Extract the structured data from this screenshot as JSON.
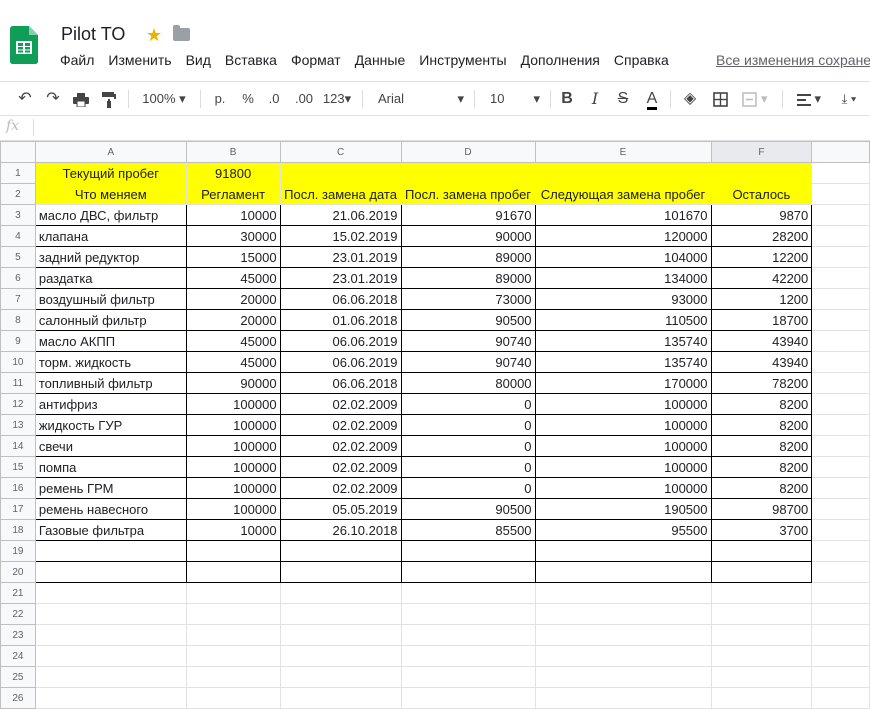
{
  "app": {
    "title": "Pilot TO",
    "menu": [
      "Файл",
      "Изменить",
      "Вид",
      "Вставка",
      "Формат",
      "Данные",
      "Инструменты",
      "Дополнения",
      "Справка"
    ],
    "saved_status": "Все изменения сохранены"
  },
  "toolbar": {
    "zoom": "100%",
    "currency": "р.",
    "percent": "%",
    "dec_less": ".0",
    "dec_more": ".00",
    "format": "123",
    "font": "Arial",
    "font_size": "10",
    "bold": "B",
    "italic": "I",
    "strike": "S",
    "text_color": "A"
  },
  "formula_bar": {
    "fx": "fx",
    "value": ""
  },
  "sheet": {
    "columns": [
      "A",
      "B",
      "C",
      "D",
      "E",
      "F"
    ],
    "selected_column": "F",
    "row1": {
      "a": "Текущий пробег",
      "b": "91800"
    },
    "headers": [
      "Что меняем",
      "Регламент",
      "Посл. замена дата",
      "Посл. замена пробег",
      "Следующая замена пробег",
      "Осталось"
    ],
    "rows": [
      [
        "масло ДВС, фильтр",
        "10000",
        "21.06.2019",
        "91670",
        "101670",
        "9870"
      ],
      [
        "клапана",
        "30000",
        "15.02.2019",
        "90000",
        "120000",
        "28200"
      ],
      [
        "задний редуктор",
        "15000",
        "23.01.2019",
        "89000",
        "104000",
        "12200"
      ],
      [
        "раздатка",
        "45000",
        "23.01.2019",
        "89000",
        "134000",
        "42200"
      ],
      [
        "воздушный фильтр",
        "20000",
        "06.06.2018",
        "73000",
        "93000",
        "1200"
      ],
      [
        "салонный фильтр",
        "20000",
        "01.06.2018",
        "90500",
        "110500",
        "18700"
      ],
      [
        "масло АКПП",
        "45000",
        "06.06.2019",
        "90740",
        "135740",
        "43940"
      ],
      [
        "торм. жидкость",
        "45000",
        "06.06.2019",
        "90740",
        "135740",
        "43940"
      ],
      [
        "топливный фильтр",
        "90000",
        "06.06.2018",
        "80000",
        "170000",
        "78200"
      ],
      [
        "антифриз",
        "100000",
        "02.02.2009",
        "0",
        "100000",
        "8200"
      ],
      [
        "жидкость ГУР",
        "100000",
        "02.02.2009",
        "0",
        "100000",
        "8200"
      ],
      [
        "свечи",
        "100000",
        "02.02.2009",
        "0",
        "100000",
        "8200"
      ],
      [
        "помпа",
        "100000",
        "02.02.2009",
        "0",
        "100000",
        "8200"
      ],
      [
        "ремень ГРМ",
        "100000",
        "02.02.2009",
        "0",
        "100000",
        "8200"
      ],
      [
        "ремень навесного",
        "100000",
        "05.05.2019",
        "90500",
        "190500",
        "98700"
      ],
      [
        "Газовые фильтра",
        "10000",
        "26.10.2018",
        "85500",
        "95500",
        "3700"
      ]
    ],
    "row_numbers": [
      "1",
      "2",
      "3",
      "4",
      "5",
      "6",
      "7",
      "8",
      "9",
      "10",
      "11",
      "12",
      "13",
      "14",
      "15",
      "16",
      "17",
      "18",
      "19",
      "20",
      "21",
      "22",
      "23",
      "24",
      "25",
      "26"
    ]
  }
}
